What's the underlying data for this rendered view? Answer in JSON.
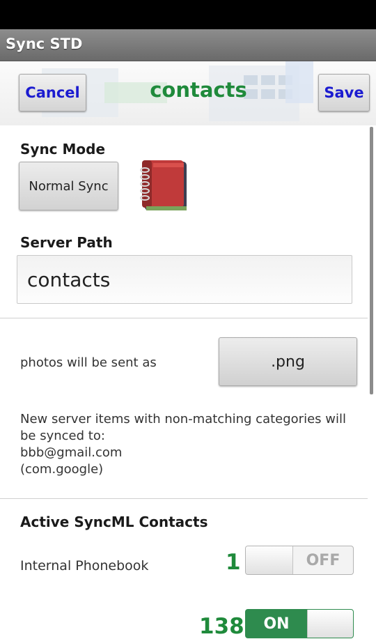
{
  "app": {
    "window_title": "Sync STD"
  },
  "toolbar": {
    "cancel_label": "Cancel",
    "title": "contacts",
    "save_label": "Save"
  },
  "sync_mode": {
    "label": "Sync Mode",
    "value": "Normal Sync",
    "icon": "address-book-icon"
  },
  "server_path": {
    "label": "Server Path",
    "value": "contacts"
  },
  "photos": {
    "label": "photos will be sent as",
    "format": ".png"
  },
  "info": {
    "line1": "New server items with non-matching categories will",
    "line2": "be synced to:",
    "line3": "bbb@gmail.com",
    "line4": "(com.google)"
  },
  "active_contacts": {
    "heading": "Active SyncML Contacts",
    "rows": [
      {
        "label": "Internal Phonebook",
        "count": "1",
        "toggle": "OFF"
      },
      {
        "label": "",
        "count": "138",
        "toggle": "ON"
      }
    ]
  },
  "colors": {
    "accent_green": "#1f8a3b",
    "button_blue": "#1b1bd0",
    "toggle_on": "#2e8b4e"
  }
}
